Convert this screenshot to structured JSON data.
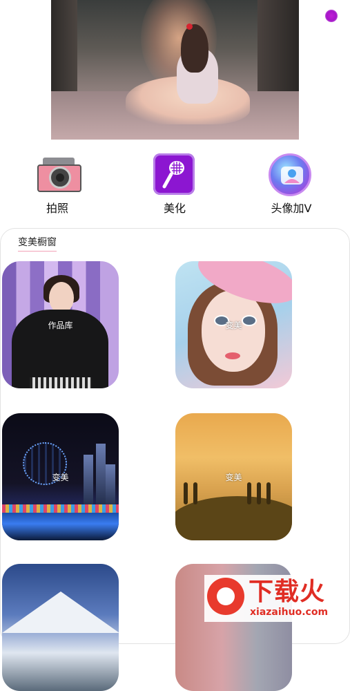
{
  "features": [
    {
      "label": "拍照"
    },
    {
      "label": "美化"
    },
    {
      "label": "头像加V"
    }
  ],
  "section": {
    "title": "变美橱窗",
    "tiles": [
      {
        "caption": "作品库"
      },
      {
        "caption": "变美"
      },
      {
        "caption": "变美"
      },
      {
        "caption": "变美"
      },
      {
        "caption": ""
      },
      {
        "caption": ""
      }
    ]
  },
  "watermark": {
    "brand": "下载火",
    "url": "xiazaihuo.com"
  },
  "colors": {
    "beauty_purple": "#8c16d1",
    "accent_dot": "#a516c9",
    "watermark_red": "#e02d24"
  }
}
